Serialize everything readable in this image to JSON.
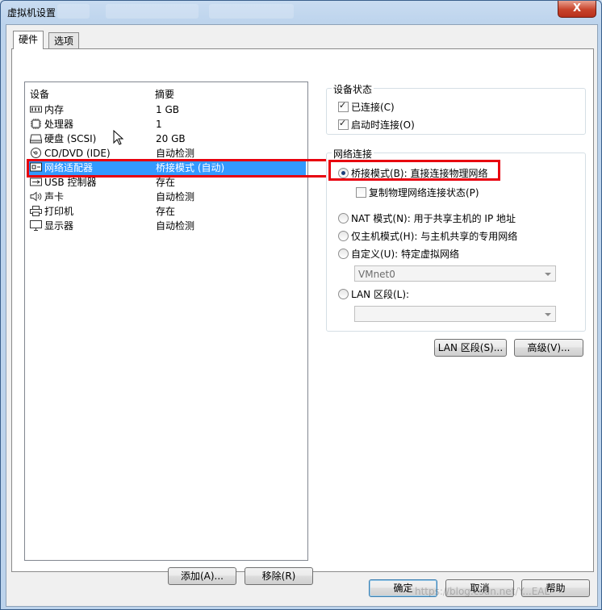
{
  "window": {
    "title": "虚拟机设置",
    "close_glyph": "X"
  },
  "tabs": [
    {
      "label": "硬件"
    },
    {
      "label": "选项"
    }
  ],
  "device_list": {
    "headers": {
      "device": "设备",
      "summary": "摘要"
    },
    "rows": [
      {
        "name": "内存",
        "summary": "1 GB",
        "icon": "memory-icon"
      },
      {
        "name": "处理器",
        "summary": "1",
        "icon": "cpu-icon"
      },
      {
        "name": "硬盘 (SCSI)",
        "summary": "20 GB",
        "icon": "hard-disk-icon"
      },
      {
        "name": "CD/DVD (IDE)",
        "summary": "自动检测",
        "icon": "cd-dvd-icon"
      },
      {
        "name": "网络适配器",
        "summary": "桥接模式 (自动)",
        "icon": "network-adapter-icon",
        "selected": true
      },
      {
        "name": "USB 控制器",
        "summary": "存在",
        "icon": "usb-icon"
      },
      {
        "name": "声卡",
        "summary": "自动检测",
        "icon": "speaker-icon"
      },
      {
        "name": "打印机",
        "summary": "存在",
        "icon": "printer-icon"
      },
      {
        "name": "显示器",
        "summary": "自动检测",
        "icon": "monitor-icon"
      }
    ],
    "add_button": "添加(A)...",
    "remove_button": "移除(R)"
  },
  "device_status": {
    "label": "设备状态",
    "connected": {
      "label": "已连接(C)",
      "checked": true
    },
    "connect_at_power_on": {
      "label": "启动时连接(O)",
      "checked": true
    }
  },
  "network_connection": {
    "label": "网络连接",
    "bridged": {
      "label": "桥接模式(B): 直接连接物理网络",
      "selected": true
    },
    "replicate": {
      "label": "复制物理网络连接状态(P)",
      "checked": false
    },
    "nat": {
      "label": "NAT 模式(N): 用于共享主机的 IP 地址",
      "selected": false
    },
    "host_only": {
      "label": "仅主机模式(H): 与主机共享的专用网络",
      "selected": false
    },
    "custom": {
      "label": "自定义(U): 特定虚拟网络",
      "selected": false,
      "value": "VMnet0"
    },
    "lan_segment": {
      "label": "LAN 区段(L):",
      "selected": false,
      "value": ""
    }
  },
  "side_buttons": {
    "lan_segments": "LAN 区段(S)...",
    "advanced": "高级(V)..."
  },
  "footer": {
    "ok": "确定",
    "cancel": "取消",
    "help": "帮助"
  },
  "watermark": "https://blog.csdn.net/Y...EAL",
  "colors": {
    "selection": "#3399ff",
    "highlight_box": "#e8000e"
  }
}
